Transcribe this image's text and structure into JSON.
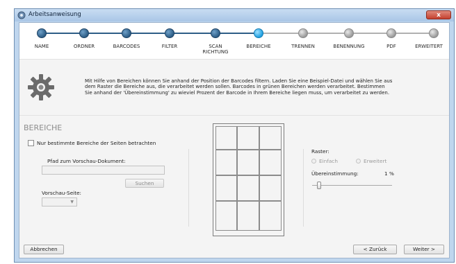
{
  "window": {
    "title": "Arbeitsanweisung",
    "close_label": "x"
  },
  "steps": [
    {
      "label": "NAME",
      "state": "done"
    },
    {
      "label": "ORDNER",
      "state": "done"
    },
    {
      "label": "BARCODES",
      "state": "done"
    },
    {
      "label": "FILTER",
      "state": "done"
    },
    {
      "label": "SCAN\nRICHTUNG",
      "state": "done"
    },
    {
      "label": "BEREICHE",
      "state": "active"
    },
    {
      "label": "TRENNEN",
      "state": "todo"
    },
    {
      "label": "BENENNUNG",
      "state": "todo"
    },
    {
      "label": "PDF",
      "state": "todo"
    },
    {
      "label": "ERWEITERT",
      "state": "todo"
    }
  ],
  "info": {
    "icon": "gear-icon",
    "line1": "Mit Hilfe von Bereichen können Sie anhand der Position der Barcodes filtern. Laden Sie eine Beispiel-Datei und wählen Sie aus",
    "line2": "dem Raster die Bereiche aus, die verarbeitet werden sollen. Barcodes in grünen Bereichen werden verarbeitet. Bestimmen",
    "line3": "Sie anhand der 'Übereinstimmung' zu wieviel Prozent der Barcode in Ihrem Bereiche liegen muss, um verarbeitet zu werden."
  },
  "bereiche": {
    "title": "BEREICHE",
    "checkbox_label": "Nur bestimmte Bereiche der Seiten betrachten",
    "checkbox_checked": false,
    "path_label": "Pfad zum Vorschau-Dokument:",
    "path_value": "",
    "search_button": "Suchen",
    "page_label": "Vorschau-Seite:",
    "page_value": ""
  },
  "raster": {
    "label": "Raster:",
    "options": [
      "Einfach",
      "Erweitert"
    ],
    "match_label": "Übereinstimmung:",
    "match_value": "1 %",
    "slider_percent": 1
  },
  "footer": {
    "cancel": "Abbrechen",
    "back": "< Zurück",
    "next": "Weiter >"
  },
  "colors": {
    "done": "#2d5d86",
    "active": "#1f9fe0",
    "todo": "#9a9a9a"
  }
}
